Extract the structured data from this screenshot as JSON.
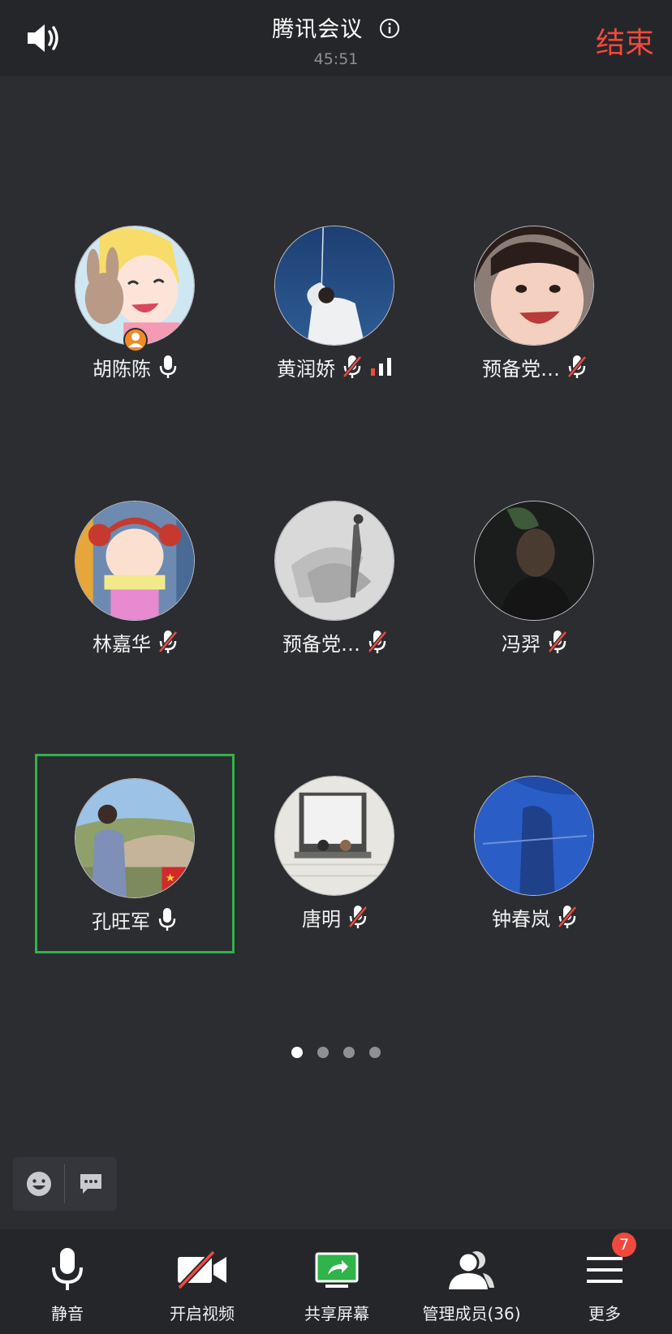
{
  "header": {
    "title": "腾讯会议",
    "timer": "45:51",
    "end_label": "结束",
    "speaker_icon": "speaker-icon",
    "info_icon": "info-icon"
  },
  "participants": [
    {
      "name": "胡陈陈",
      "mic": "on",
      "host": true
    },
    {
      "name": "黄润娇",
      "mic": "muted",
      "signal": true
    },
    {
      "name": "预备党…",
      "mic": "muted"
    },
    {
      "name": "林嘉华",
      "mic": "muted"
    },
    {
      "name": "预备党…",
      "mic": "muted"
    },
    {
      "name": "冯羿",
      "mic": "muted"
    },
    {
      "name": "孔旺军",
      "mic": "on",
      "active": true
    },
    {
      "name": "唐明",
      "mic": "muted"
    },
    {
      "name": "钟春岚",
      "mic": "muted"
    }
  ],
  "pager": {
    "count": 4,
    "current": 1
  },
  "toolbar": {
    "mute_label": "静音",
    "video_label": "开启视频",
    "share_label": "共享屏幕",
    "members_label": "管理成员(36)",
    "more_label": "更多",
    "more_badge": "7"
  },
  "colors": {
    "accent_end": "#f0493e",
    "active_border": "#2fb34a",
    "share_green": "#2fb34a",
    "background": "#2c2d31"
  }
}
